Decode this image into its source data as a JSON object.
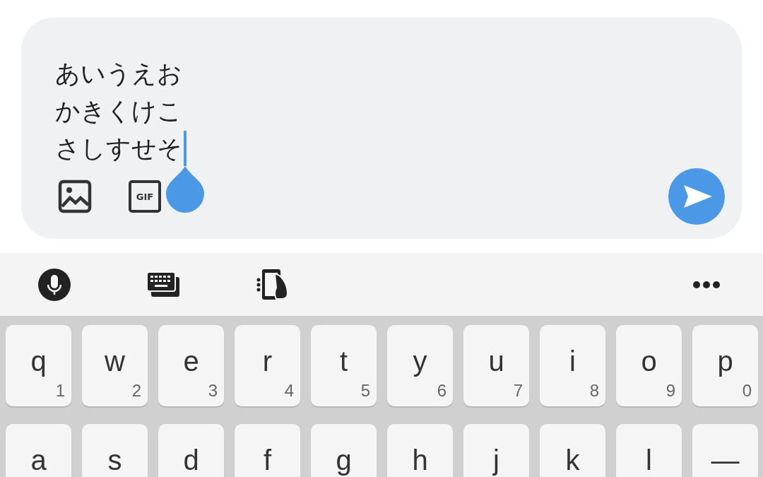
{
  "composer": {
    "lines": [
      "あいうえお",
      "かきくけこ",
      "さしすせそ"
    ],
    "gif_label": "GIF"
  },
  "keyboard": {
    "rows": [
      [
        {
          "letter": "q",
          "hint": "1"
        },
        {
          "letter": "w",
          "hint": "2"
        },
        {
          "letter": "e",
          "hint": "3"
        },
        {
          "letter": "r",
          "hint": "4"
        },
        {
          "letter": "t",
          "hint": "5"
        },
        {
          "letter": "y",
          "hint": "6"
        },
        {
          "letter": "u",
          "hint": "7"
        },
        {
          "letter": "i",
          "hint": "8"
        },
        {
          "letter": "o",
          "hint": "9"
        },
        {
          "letter": "p",
          "hint": "0"
        }
      ],
      [
        {
          "letter": "a"
        },
        {
          "letter": "s"
        },
        {
          "letter": "d"
        },
        {
          "letter": "f"
        },
        {
          "letter": "g"
        },
        {
          "letter": "h"
        },
        {
          "letter": "j"
        },
        {
          "letter": "k"
        },
        {
          "letter": "l"
        },
        {
          "letter": "—"
        }
      ]
    ]
  }
}
